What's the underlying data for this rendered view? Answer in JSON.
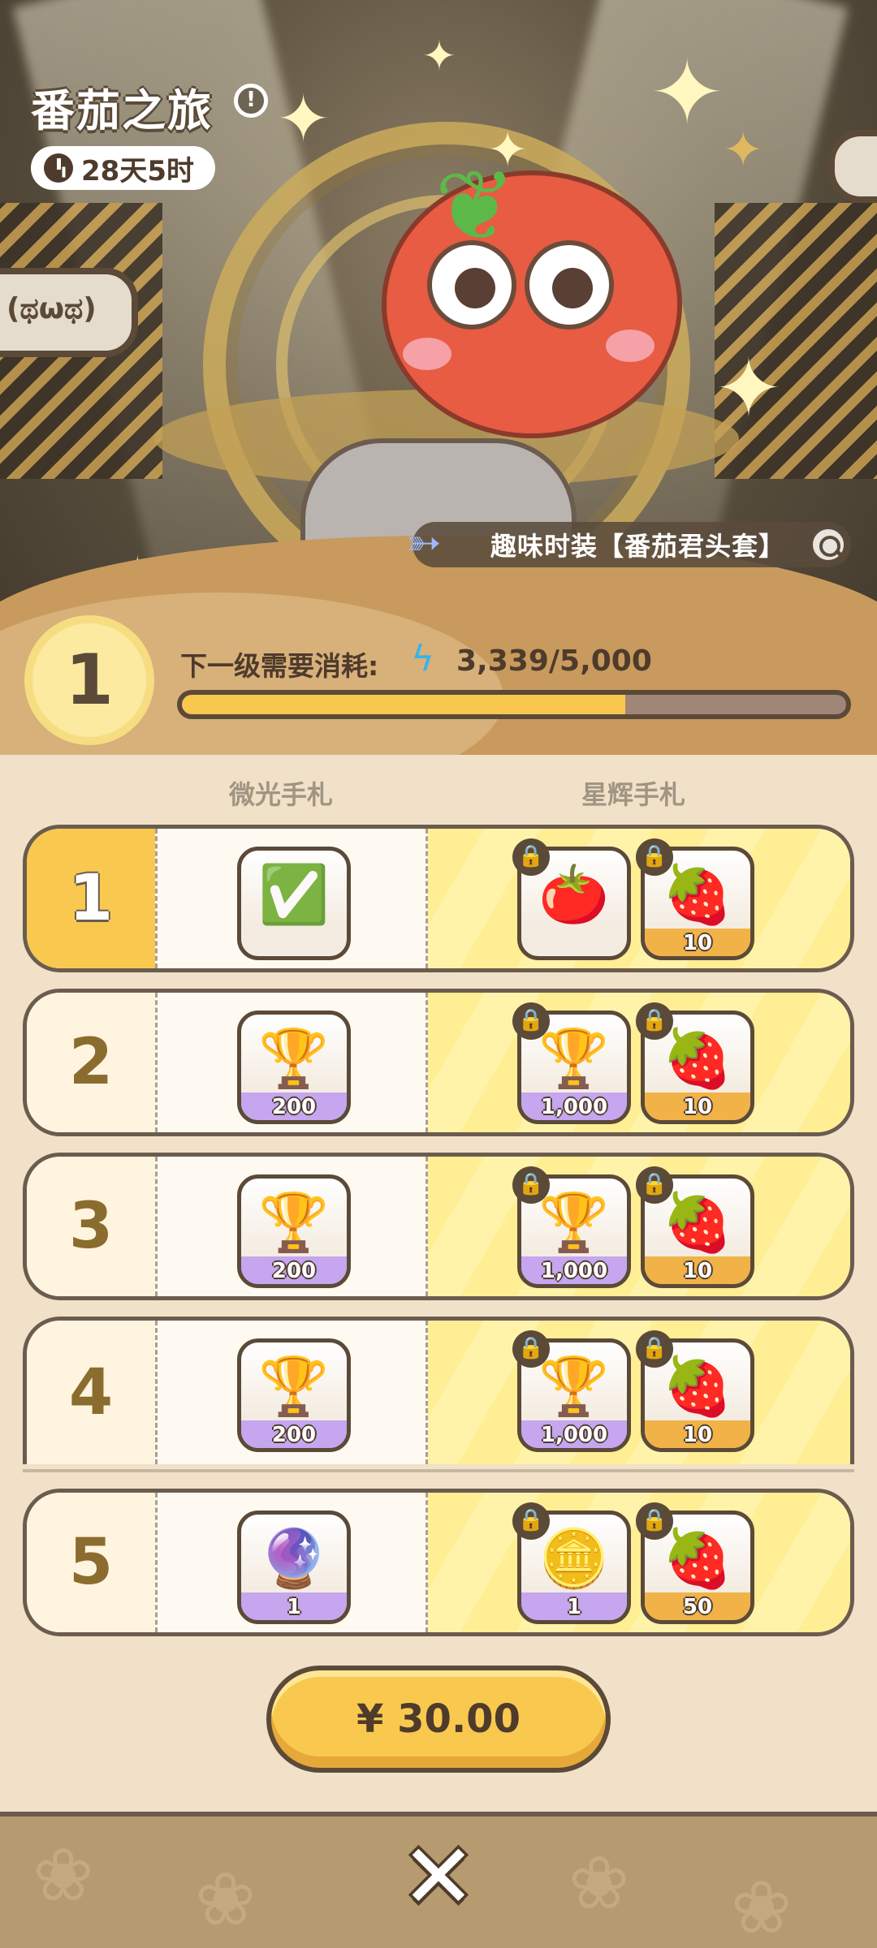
{
  "header": {
    "title": "番茄之旅",
    "info_icon": "info-icon",
    "timer": "28天5时",
    "timer_icon": "clock-icon"
  },
  "chat_bubbles": {
    "left": "(ಥωಥ)",
    "right": "(·"
  },
  "costume": {
    "label": "趣味时装【番茄君头套】",
    "icon": "sparkle-ticket-icon",
    "search_icon": "magnifier-icon"
  },
  "level": {
    "current": "1",
    "next_label": "下一级需要消耗:",
    "currency_icon": "lightning-icon",
    "progress_text": "3,339/5,000",
    "progress_value": 3339,
    "progress_max": 5000
  },
  "columns": {
    "free": "微光手札",
    "paid": "星辉手札"
  },
  "rows": [
    {
      "level": "1",
      "free": {
        "icon": "tomato-wreath-badge-icon",
        "qty": ""
      },
      "paid": [
        {
          "icon": "tomato-costume-card-icon",
          "qty": ""
        },
        {
          "icon": "tomato-sticker-icon",
          "qty": "10"
        }
      ]
    },
    {
      "level": "2",
      "free": {
        "icon": "golden-trophy-icon",
        "qty": "200"
      },
      "paid": [
        {
          "icon": "golden-trophy-icon",
          "qty": "1,000"
        },
        {
          "icon": "tomato-sticker-icon",
          "qty": "10"
        }
      ]
    },
    {
      "level": "3",
      "free": {
        "icon": "golden-trophy-icon",
        "qty": "200"
      },
      "paid": [
        {
          "icon": "golden-trophy-icon",
          "qty": "1,000"
        },
        {
          "icon": "tomato-sticker-icon",
          "qty": "10"
        }
      ]
    },
    {
      "level": "4",
      "free": {
        "icon": "golden-trophy-icon",
        "qty": "200"
      },
      "paid": [
        {
          "icon": "golden-trophy-icon",
          "qty": "1,000"
        },
        {
          "icon": "tomato-sticker-icon",
          "qty": "10"
        }
      ]
    },
    {
      "level": "5",
      "free": {
        "icon": "magic-fruit-icon",
        "qty": "1"
      },
      "paid": [
        {
          "icon": "gold-coin-icon",
          "qty": "1"
        },
        {
          "icon": "tomato-sticker-icon",
          "qty": "50"
        }
      ]
    }
  ],
  "purchase": {
    "price": "¥ 30.00"
  },
  "footer": {
    "close_icon": "close-icon"
  },
  "colors": {
    "accent_yellow": "#f8c94e",
    "outline_brown": "#5b4a38",
    "background": "#f1e1c8"
  }
}
